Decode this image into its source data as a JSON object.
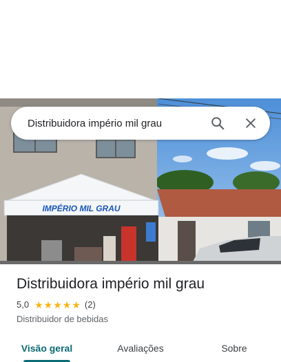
{
  "search": {
    "query": "Distribuidora império mil grau"
  },
  "place": {
    "name": "Distribuidora império mil grau",
    "rating": "5,0",
    "stars": 5,
    "review_count": "(2)",
    "category": "Distribuidor de bebidas"
  },
  "photo": {
    "sign_text": "IMPÉRIO MIL GRAU"
  },
  "tabs": [
    {
      "label": "Visão geral",
      "active": true
    },
    {
      "label": "Avaliações",
      "active": false
    },
    {
      "label": "Sobre",
      "active": false
    }
  ],
  "colors": {
    "accent": "#0b6a73",
    "star": "#f8b415"
  },
  "icons": {
    "search": "search-icon",
    "close": "close-icon",
    "star": "star-icon"
  }
}
